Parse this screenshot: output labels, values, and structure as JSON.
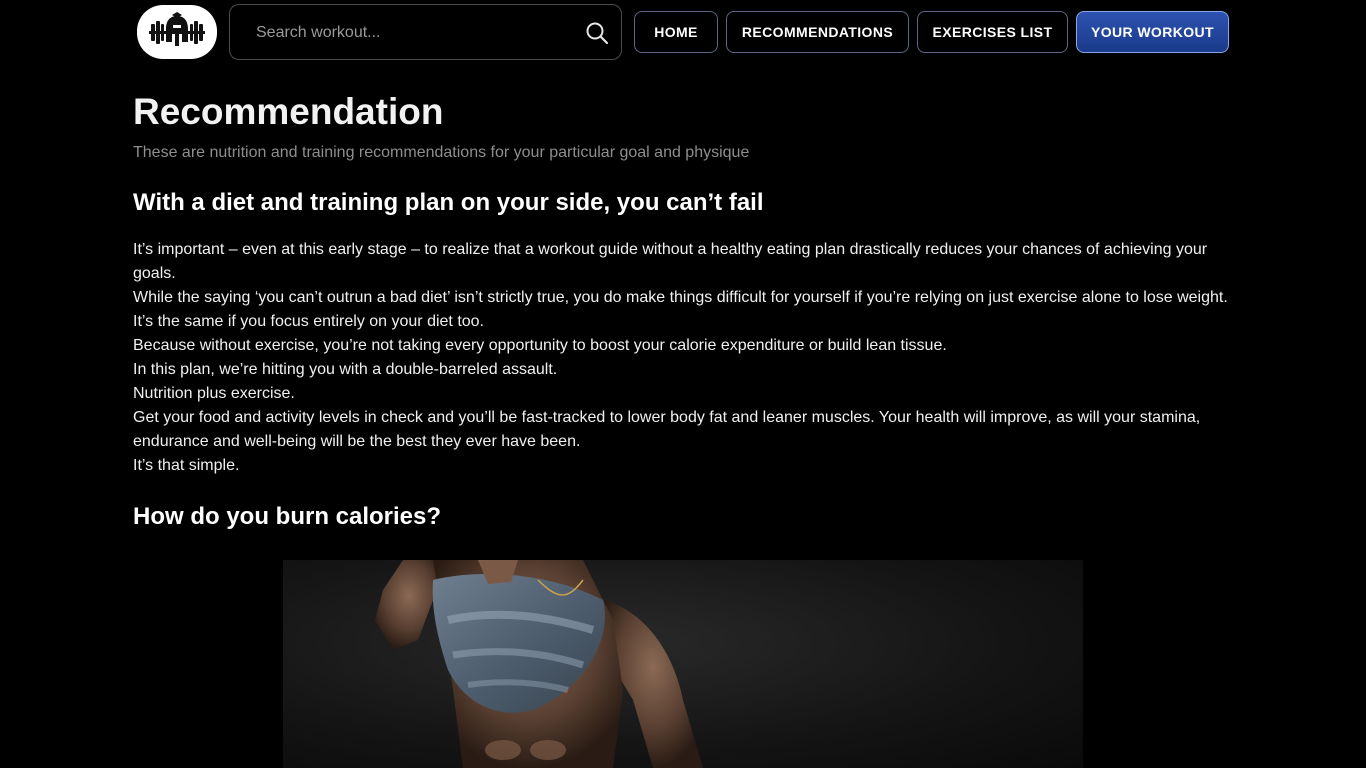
{
  "header": {
    "search": {
      "placeholder": "Search workout...",
      "icon": "search-icon"
    },
    "nav": [
      {
        "label": "HOME"
      },
      {
        "label": "RECOMMENDATIONS"
      },
      {
        "label": "EXERCISES LIST"
      },
      {
        "label": "YOUR WORKOUT",
        "active": true
      }
    ]
  },
  "main": {
    "title": "Recommendation",
    "subtitle": "These are nutrition and training recommendations for your particular goal and physique",
    "section1": {
      "heading": "With a diet and training plan on your side, you can’t fail",
      "paragraphs": [
        "It’s important – even at this early stage – to realize that a workout guide without a healthy eating plan drastically reduces your chances of achieving your goals.",
        "While the saying ‘you can’t outrun a bad diet’ isn’t strictly true, you do make things difficult for yourself if you’re relying on just exercise alone to lose weight.",
        "It’s the same if you focus entirely on your diet too.",
        "Because without exercise, you’re not taking every opportunity to boost your calorie expenditure or build lean tissue.",
        "In this plan, we’re hitting you with a double-barreled assault.",
        "Nutrition plus exercise.",
        "Get your food and activity levels in check and you’ll be fast-tracked to lower body fat and leaner muscles. Your health will improve, as will your stamina, endurance and well-being will be the best they ever have been.",
        "It’s that simple."
      ]
    },
    "section2": {
      "heading": "How do you burn calories?"
    }
  },
  "colors": {
    "background": "#000000",
    "accent": "#2d52b0",
    "muted_text": "#8e8e8e"
  }
}
